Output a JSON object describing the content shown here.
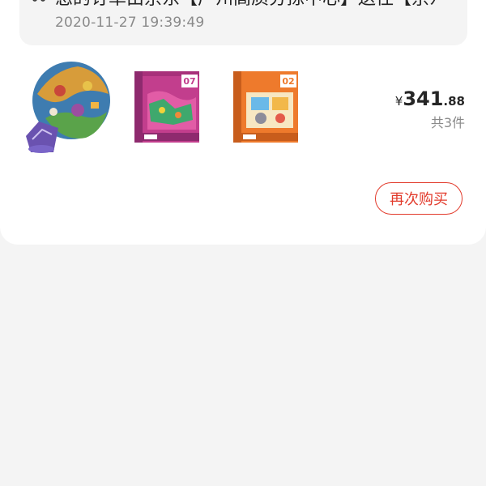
{
  "order": {
    "logistics": {
      "icon": "truck-icon",
      "status_text": "您的订单由京东【广州高质分拣中心】送往【京东专线】",
      "time": "2020-11-27 19:39:49"
    },
    "products": [
      {
        "name": "circular-puzzle-thumbnail",
        "accent": "#2a6fa8"
      },
      {
        "name": "level-07-puzzle-thumbnail",
        "accent": "#c03a8a"
      },
      {
        "name": "level-02-puzzle-thumbnail",
        "accent": "#e8752a"
      }
    ],
    "price": {
      "symbol": "¥",
      "integer": "341",
      "decimal": ".88"
    },
    "count_text": "共3件",
    "rebuy_label": "再次购买"
  },
  "colors": {
    "accent_red": "#e23b2c",
    "page_bg": "#f4f4f4",
    "card_bg": "#ffffff"
  }
}
